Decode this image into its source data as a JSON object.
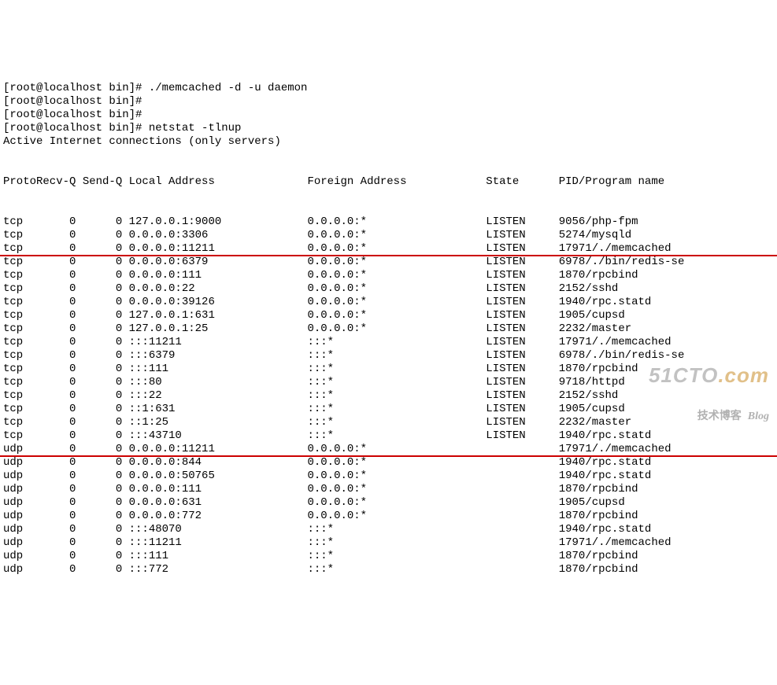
{
  "prompt_lines": [
    "[root@localhost bin]# ./memcached -d -u daemon",
    "[root@localhost bin]# ",
    "[root@localhost bin]# ",
    "[root@localhost bin]# netstat -tlnup",
    "Active Internet connections (only servers)"
  ],
  "header": {
    "proto": "Proto",
    "recvq": "Recv-Q",
    "sendq": "Send-Q",
    "local": "Local Address",
    "foreign": "Foreign Address",
    "state": "State",
    "pid": "PID/Program name"
  },
  "rows": [
    {
      "proto": "tcp",
      "recvq": "0",
      "sendq": "0",
      "local": "127.0.0.1:9000",
      "foreign": "0.0.0.0:*",
      "state": "LISTEN",
      "pid": "9056/php-fpm"
    },
    {
      "proto": "tcp",
      "recvq": "0",
      "sendq": "0",
      "local": "0.0.0.0:3306",
      "foreign": "0.0.0.0:*",
      "state": "LISTEN",
      "pid": "5274/mysqld"
    },
    {
      "proto": "tcp",
      "recvq": "0",
      "sendq": "0",
      "local": "0.0.0.0:11211",
      "foreign": "0.0.0.0:*",
      "state": "LISTEN",
      "pid": "17971/./memcached"
    },
    {
      "proto": "tcp",
      "recvq": "0",
      "sendq": "0",
      "local": "0.0.0.0:6379",
      "foreign": "0.0.0.0:*",
      "state": "LISTEN",
      "pid": "6978/./bin/redis-se"
    },
    {
      "proto": "tcp",
      "recvq": "0",
      "sendq": "0",
      "local": "0.0.0.0:111",
      "foreign": "0.0.0.0:*",
      "state": "LISTEN",
      "pid": "1870/rpcbind"
    },
    {
      "proto": "tcp",
      "recvq": "0",
      "sendq": "0",
      "local": "0.0.0.0:22",
      "foreign": "0.0.0.0:*",
      "state": "LISTEN",
      "pid": "2152/sshd"
    },
    {
      "proto": "tcp",
      "recvq": "0",
      "sendq": "0",
      "local": "0.0.0.0:39126",
      "foreign": "0.0.0.0:*",
      "state": "LISTEN",
      "pid": "1940/rpc.statd"
    },
    {
      "proto": "tcp",
      "recvq": "0",
      "sendq": "0",
      "local": "127.0.0.1:631",
      "foreign": "0.0.0.0:*",
      "state": "LISTEN",
      "pid": "1905/cupsd"
    },
    {
      "proto": "tcp",
      "recvq": "0",
      "sendq": "0",
      "local": "127.0.0.1:25",
      "foreign": "0.0.0.0:*",
      "state": "LISTEN",
      "pid": "2232/master"
    },
    {
      "proto": "tcp",
      "recvq": "0",
      "sendq": "0",
      "local": ":::11211",
      "foreign": ":::*",
      "state": "LISTEN",
      "pid": "17971/./memcached"
    },
    {
      "proto": "tcp",
      "recvq": "0",
      "sendq": "0",
      "local": ":::6379",
      "foreign": ":::*",
      "state": "LISTEN",
      "pid": "6978/./bin/redis-se"
    },
    {
      "proto": "tcp",
      "recvq": "0",
      "sendq": "0",
      "local": ":::111",
      "foreign": ":::*",
      "state": "LISTEN",
      "pid": "1870/rpcbind"
    },
    {
      "proto": "tcp",
      "recvq": "0",
      "sendq": "0",
      "local": ":::80",
      "foreign": ":::*",
      "state": "LISTEN",
      "pid": "9718/httpd"
    },
    {
      "proto": "tcp",
      "recvq": "0",
      "sendq": "0",
      "local": ":::22",
      "foreign": ":::*",
      "state": "LISTEN",
      "pid": "2152/sshd"
    },
    {
      "proto": "tcp",
      "recvq": "0",
      "sendq": "0",
      "local": "::1:631",
      "foreign": ":::*",
      "state": "LISTEN",
      "pid": "1905/cupsd"
    },
    {
      "proto": "tcp",
      "recvq": "0",
      "sendq": "0",
      "local": "::1:25",
      "foreign": ":::*",
      "state": "LISTEN",
      "pid": "2232/master"
    },
    {
      "proto": "tcp",
      "recvq": "0",
      "sendq": "0",
      "local": ":::43710",
      "foreign": ":::*",
      "state": "LISTEN",
      "pid": "1940/rpc.statd"
    },
    {
      "proto": "udp",
      "recvq": "0",
      "sendq": "0",
      "local": "0.0.0.0:11211",
      "foreign": "0.0.0.0:*",
      "state": "",
      "pid": "17971/./memcached"
    },
    {
      "proto": "udp",
      "recvq": "0",
      "sendq": "0",
      "local": "0.0.0.0:844",
      "foreign": "0.0.0.0:*",
      "state": "",
      "pid": "1940/rpc.statd"
    },
    {
      "proto": "udp",
      "recvq": "0",
      "sendq": "0",
      "local": "0.0.0.0:50765",
      "foreign": "0.0.0.0:*",
      "state": "",
      "pid": "1940/rpc.statd"
    },
    {
      "proto": "udp",
      "recvq": "0",
      "sendq": "0",
      "local": "0.0.0.0:111",
      "foreign": "0.0.0.0:*",
      "state": "",
      "pid": "1870/rpcbind"
    },
    {
      "proto": "udp",
      "recvq": "0",
      "sendq": "0",
      "local": "0.0.0.0:631",
      "foreign": "0.0.0.0:*",
      "state": "",
      "pid": "1905/cupsd"
    },
    {
      "proto": "udp",
      "recvq": "0",
      "sendq": "0",
      "local": "0.0.0.0:772",
      "foreign": "0.0.0.0:*",
      "state": "",
      "pid": "1870/rpcbind"
    },
    {
      "proto": "udp",
      "recvq": "0",
      "sendq": "0",
      "local": ":::48070",
      "foreign": ":::*",
      "state": "",
      "pid": "1940/rpc.statd"
    },
    {
      "proto": "udp",
      "recvq": "0",
      "sendq": "0",
      "local": ":::11211",
      "foreign": ":::*",
      "state": "",
      "pid": "17971/./memcached"
    },
    {
      "proto": "udp",
      "recvq": "0",
      "sendq": "0",
      "local": ":::111",
      "foreign": ":::*",
      "state": "",
      "pid": "1870/rpcbind"
    },
    {
      "proto": "udp",
      "recvq": "0",
      "sendq": "0",
      "local": ":::772",
      "foreign": ":::*",
      "state": "",
      "pid": "1870/rpcbind"
    }
  ],
  "highlight_after_row_indexes": [
    2,
    17
  ],
  "watermark": {
    "site_main": "51CTO",
    "site_suffix": ".com",
    "subtitle_cn": "技术博客",
    "subtitle_en": "Blog"
  }
}
